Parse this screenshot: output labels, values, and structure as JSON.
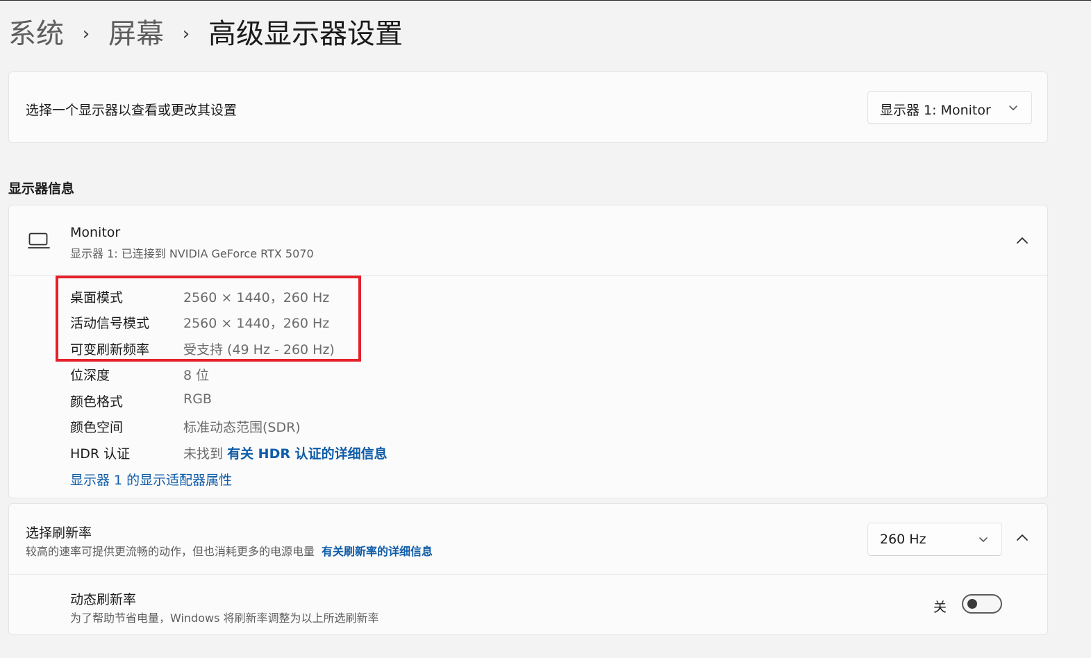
{
  "breadcrumb": {
    "items": [
      "系统",
      "屏幕"
    ],
    "separator": "›",
    "current": "高级显示器设置"
  },
  "display_select": {
    "label": "选择一个显示器以查看或更改其设置",
    "value": "显示器 1: Monitor"
  },
  "display_info": {
    "section_title": "显示器信息",
    "monitor_name": "Monitor",
    "monitor_sub": "显示器 1: 已连接到 NVIDIA GeForce RTX 5070",
    "icon": "monitor-icon",
    "properties": [
      {
        "label": "桌面模式",
        "value": "2560 × 1440，260 Hz"
      },
      {
        "label": "活动信号模式",
        "value": "2560 × 1440，260 Hz"
      },
      {
        "label": "可变刷新频率",
        "value": "受支持 (49 Hz - 260 Hz)"
      },
      {
        "label": "位深度",
        "value": "8 位"
      },
      {
        "label": "颜色格式",
        "value": "RGB"
      },
      {
        "label": "颜色空间",
        "value": "标准动态范围(SDR)"
      }
    ],
    "hdr": {
      "label": "HDR 认证",
      "value": "未找到",
      "link": "有关 HDR 认证的详细信息"
    },
    "adapter_link": "显示器 1 的显示适配器属性"
  },
  "refresh_rate": {
    "title": "选择刷新率",
    "description": "较高的速率可提供更流畅的动作，但也消耗更多的电源电量",
    "link": "有关刷新率的详细信息",
    "value": "260 Hz"
  },
  "dynamic_refresh": {
    "title": "动态刷新率",
    "description": "为了帮助节省电量，Windows 将刷新率调整为以上所选刷新率",
    "toggle_label": "关",
    "toggle_on": false
  },
  "colors": {
    "accent_link": "#0f5ca8",
    "highlight": "#e5202a",
    "background": "#f3f3f3",
    "card": "#fbfbfb"
  }
}
